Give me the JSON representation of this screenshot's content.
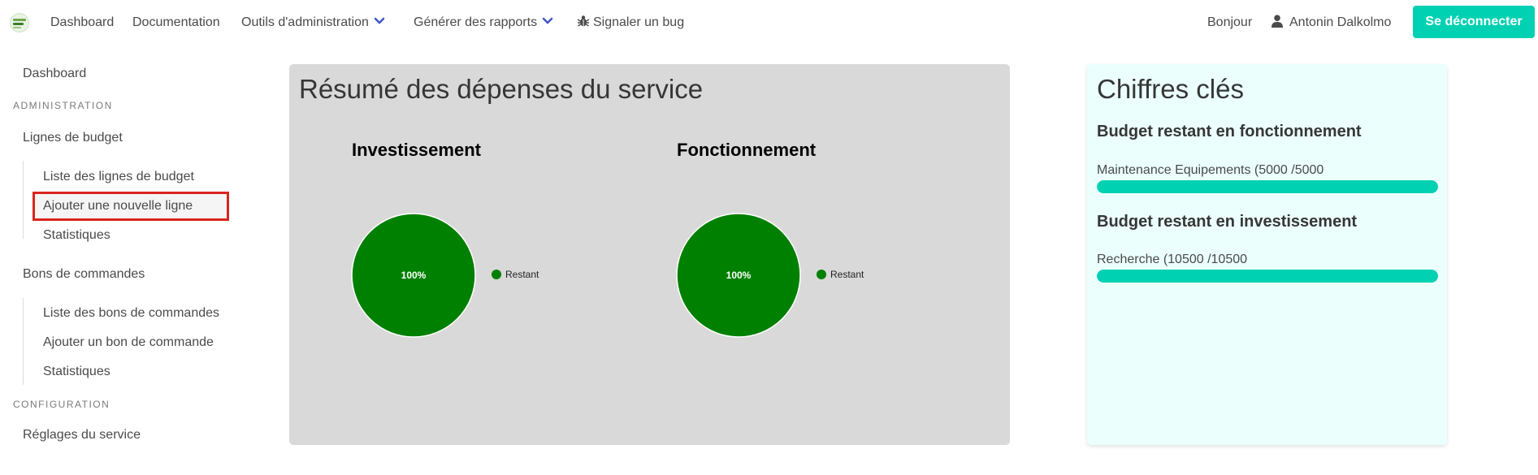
{
  "navbar": {
    "items": [
      "Dashboard",
      "Documentation",
      "Outils d'administration",
      "Générer des rapports",
      "Signaler un bug"
    ],
    "greeting": "Bonjour",
    "user": "Antonin Dalkolmo",
    "logout": "Se déconnecter"
  },
  "sidebar": {
    "dashboard": "Dashboard",
    "admin_label": "ADMINISTRATION",
    "budget_lines": "Lignes de budget",
    "budget_sub": [
      "Liste des lignes de budget",
      "Ajouter une nouvelle ligne",
      "Statistiques"
    ],
    "orders": "Bons de commandes",
    "orders_sub": [
      "Liste des bons de commandes",
      "Ajouter un bon de commande",
      "Statistiques"
    ],
    "config_label": "CONFIGURATION",
    "settings": "Réglages du service"
  },
  "summary": {
    "title": "Résumé des dépenses du service",
    "charts": [
      {
        "title": "Investissement",
        "legend": "Restant",
        "slices": [
          {
            "label": "Restant",
            "value": 100,
            "display": "100%",
            "color": "#008000"
          }
        ]
      },
      {
        "title": "Fonctionnement",
        "legend": "Restant",
        "slices": [
          {
            "label": "Restant",
            "value": 100,
            "display": "100%",
            "color": "#008000"
          }
        ]
      }
    ]
  },
  "chart_data": [
    {
      "type": "pie",
      "title": "Investissement",
      "categories": [
        "Restant"
      ],
      "values": [
        100
      ],
      "legend": "right"
    },
    {
      "type": "pie",
      "title": "Fonctionnement",
      "categories": [
        "Restant"
      ],
      "values": [
        100
      ],
      "legend": "right"
    }
  ],
  "key_figures": {
    "title": "Chiffres clés",
    "fonctionnement_title": "Budget restant en fonctionnement",
    "fonctionnement_line": "Maintenance Equipements (5000 /5000",
    "fonctionnement_progress": 1.0,
    "investissement_title": "Budget restant en investissement",
    "investissement_line": "Recherche (10500 /10500",
    "investissement_progress": 1.0
  },
  "colors": {
    "accent": "#00d1b2",
    "pie": "#008000",
    "highlight": "#d9251d"
  }
}
